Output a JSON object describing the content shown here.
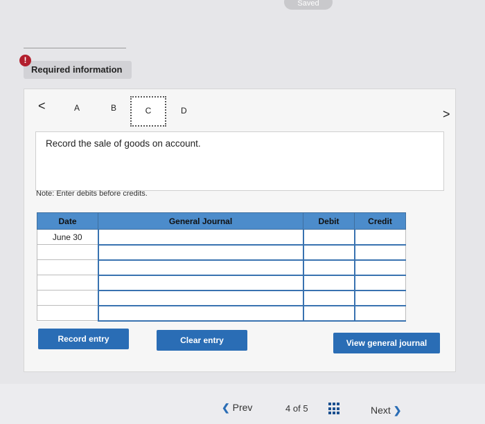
{
  "header": {
    "saved_label": "Saved"
  },
  "alert": {
    "icon": "exclamation-icon",
    "symbol": "!",
    "label": "Required information"
  },
  "tabs": {
    "left_arrow": "<",
    "right_arrow": ">",
    "items": [
      {
        "label": "A"
      },
      {
        "label": "B"
      },
      {
        "label": "C",
        "active": true
      },
      {
        "label": "D"
      }
    ]
  },
  "instruction": "Record the sale of goods on account.",
  "note": "Note: Enter debits before credits.",
  "journal": {
    "headers": {
      "date": "Date",
      "general_journal": "General Journal",
      "debit": "Debit",
      "credit": "Credit"
    },
    "rows": [
      {
        "date": "June 30",
        "account": "",
        "debit": "",
        "credit": ""
      },
      {
        "date": "",
        "account": "",
        "debit": "",
        "credit": ""
      },
      {
        "date": "",
        "account": "",
        "debit": "",
        "credit": ""
      },
      {
        "date": "",
        "account": "",
        "debit": "",
        "credit": ""
      },
      {
        "date": "",
        "account": "",
        "debit": "",
        "credit": ""
      },
      {
        "date": "",
        "account": "",
        "debit": "",
        "credit": ""
      }
    ]
  },
  "buttons": {
    "record_entry": "Record entry",
    "clear_entry": "Clear entry",
    "view_general_journal": "View general journal"
  },
  "footer": {
    "prev_label": "Prev",
    "prev_icon": "chevron-left-icon",
    "page_current": "4",
    "page_of": "of",
    "page_total": "5",
    "grid_icon": "grid-icon",
    "next_label": "Next",
    "next_icon": "chevron-right-icon"
  },
  "colors": {
    "accent": "#2a6db5",
    "alert": "#b21f2d",
    "table_header": "#4c8ccb"
  }
}
